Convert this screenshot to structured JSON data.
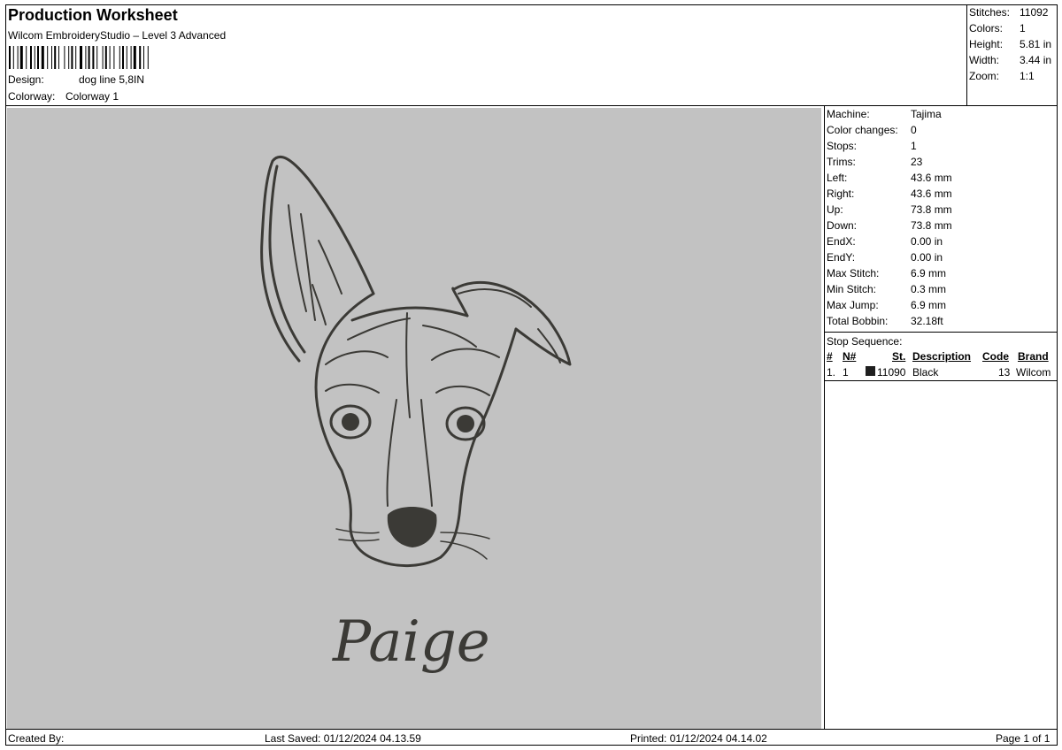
{
  "header": {
    "title": "Production Worksheet",
    "software": "Wilcom EmbroideryStudio – Level 3 Advanced",
    "design_label": "Design:",
    "design_value": "dog line 5,8IN",
    "colorway_label": "Colorway:",
    "colorway_value": "Colorway 1"
  },
  "summary": [
    {
      "label": "Stitches:",
      "value": "11092"
    },
    {
      "label": "Colors:",
      "value": "1"
    },
    {
      "label": "Height:",
      "value": "5.81 in"
    },
    {
      "label": "Width:",
      "value": "3.44 in"
    },
    {
      "label": "Zoom:",
      "value": "1:1"
    }
  ],
  "details": [
    {
      "label": "Machine:",
      "value": "Tajima"
    },
    {
      "label": "Color changes:",
      "value": "0"
    },
    {
      "label": "Stops:",
      "value": "1"
    },
    {
      "label": "Trims:",
      "value": "23"
    },
    {
      "label": "Left:",
      "value": "43.6 mm"
    },
    {
      "label": "Right:",
      "value": "43.6 mm"
    },
    {
      "label": "Up:",
      "value": "73.8 mm"
    },
    {
      "label": "Down:",
      "value": "73.8 mm"
    },
    {
      "label": "EndX:",
      "value": "0.00 in"
    },
    {
      "label": "EndY:",
      "value": "0.00 in"
    },
    {
      "label": "Max Stitch:",
      "value": "6.9 mm"
    },
    {
      "label": "Min Stitch:",
      "value": "0.3 mm"
    },
    {
      "label": "Max Jump:",
      "value": "6.9 mm"
    },
    {
      "label": "Total Bobbin:",
      "value": "32.18ft"
    }
  ],
  "stop_sequence": {
    "title": "Stop Sequence:",
    "columns": {
      "num": "#",
      "needle": "N#",
      "stitches": "St.",
      "description": "Description",
      "code": "Code",
      "brand": "Brand"
    },
    "rows": [
      {
        "num": "1.",
        "needle": "1",
        "stitches": "11090",
        "description": "Black",
        "code": "13",
        "brand": "Wilcom",
        "color": "#1e1e1e"
      }
    ]
  },
  "design": {
    "name_text": "Paige",
    "background": "#c2c2c2",
    "thread_color": "#3b3a36"
  },
  "footer": {
    "created_by": "Created By:",
    "last_saved": "Last Saved: 01/12/2024 04.13.59",
    "printed": "Printed: 01/12/2024 04.14.02",
    "page": "Page 1 of 1"
  }
}
